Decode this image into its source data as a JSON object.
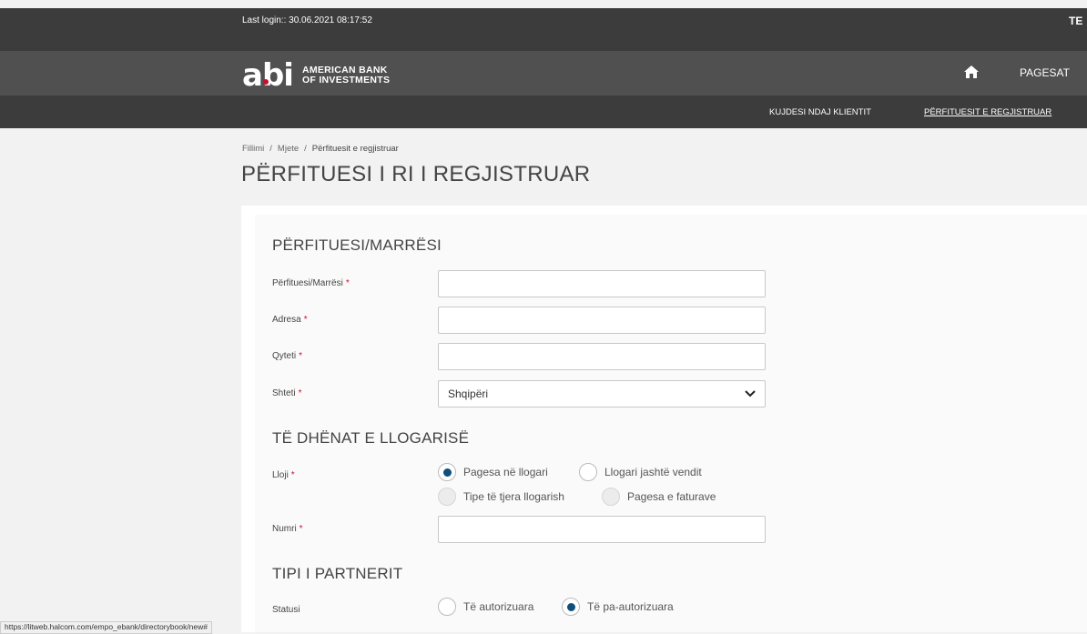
{
  "topbar": {
    "last_login": "Last login:: 30.06.2021 08:17:52",
    "right_text": "TE"
  },
  "brand": {
    "mark": "abi",
    "line1": "AMERICAN BANK",
    "line2": "OF INVESTMENTS",
    "accent": "#c8102e"
  },
  "header": {
    "home_icon": "home-icon",
    "nav_item": "PAGESAT"
  },
  "subnav": {
    "items": [
      "KUJDESI NDAJ KLIENTIT",
      "PËRFITUESIT E REGJISTRUAR"
    ],
    "active_index": 1
  },
  "breadcrumb": [
    "Fillimi",
    "Mjete",
    "Përfituesit e regjistruar"
  ],
  "breadcrumb_sep": "/",
  "page_title": "PËRFITUESI I RI I REGJISTRUAR",
  "sections": {
    "beneficiary": {
      "title": "PËRFITUESI/MARRËSI",
      "fields": [
        {
          "label": "Përfituesi/Marrësi",
          "value": ""
        },
        {
          "label": "Adresa",
          "value": ""
        },
        {
          "label": "Qyteti",
          "value": ""
        },
        {
          "label": "Shteti",
          "value": "Shqipëri"
        }
      ]
    },
    "account": {
      "title": "TË DHËNAT E LLOGARISË",
      "type_label": "Lloji",
      "type_options": [
        {
          "label": "Pagesa në llogari",
          "checked": true,
          "disabled": false
        },
        {
          "label": "Llogari jashtë vendit",
          "checked": false,
          "disabled": false
        },
        {
          "label": "Tipe të tjera llogarish",
          "checked": false,
          "disabled": true
        },
        {
          "label": "Pagesa e faturave",
          "checked": false,
          "disabled": true
        }
      ],
      "number_label": "Numri",
      "number_value": ""
    },
    "partner": {
      "title": "TIPI I PARTNERIT",
      "status_label": "Statusi",
      "status_options": [
        {
          "label": "Të autorizuara",
          "checked": false
        },
        {
          "label": "Të pa-autorizuara",
          "checked": true
        }
      ]
    }
  },
  "required_marker": "*",
  "status_bar_url": "https://litweb.halcom.com/empo_ebank/directorybook/new#",
  "colors": {
    "primary_radio": "#0f4f7a",
    "dark_bar": "#3c3c3c",
    "header_bar": "#505050"
  }
}
